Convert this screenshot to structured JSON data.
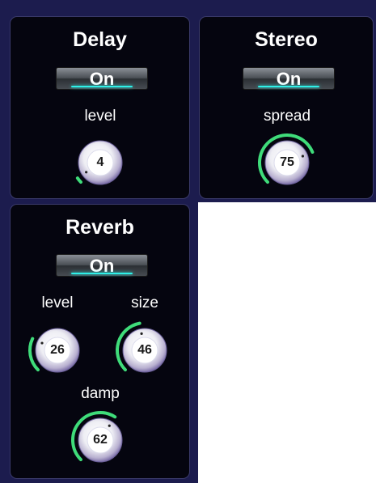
{
  "panels": {
    "delay": {
      "title": "Delay",
      "toggle_label": "On",
      "knobs": {
        "level": {
          "label": "level",
          "value": "4",
          "fraction": 0.04
        }
      }
    },
    "stereo": {
      "title": "Stereo",
      "toggle_label": "On",
      "knobs": {
        "spread": {
          "label": "spread",
          "value": "75",
          "fraction": 0.75
        }
      }
    },
    "reverb": {
      "title": "Reverb",
      "toggle_label": "On",
      "knobs": {
        "level": {
          "label": "level",
          "value": "26",
          "fraction": 0.26
        },
        "size": {
          "label": "size",
          "value": "46",
          "fraction": 0.46
        },
        "damp": {
          "label": "damp",
          "value": "62",
          "fraction": 0.62
        }
      }
    }
  },
  "colors": {
    "background": "#1c1c4e",
    "panel": "#05050f",
    "arc": "#3fdc7a",
    "toggle_glow": "#2ef0e8"
  }
}
